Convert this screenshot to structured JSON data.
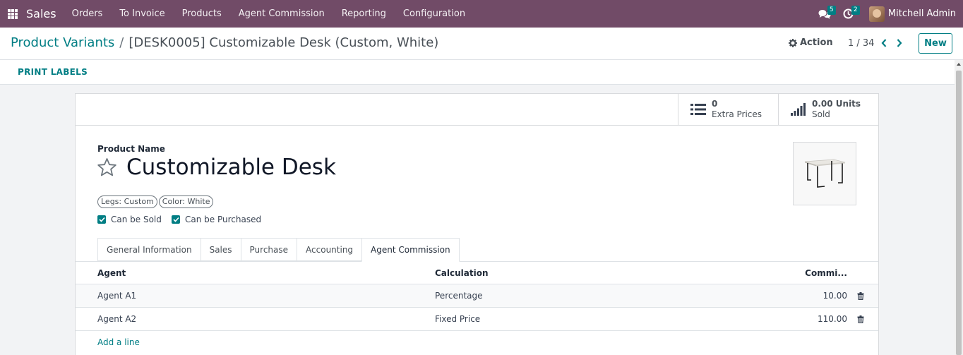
{
  "navbar": {
    "app_name": "Sales",
    "menu": [
      "Orders",
      "To Invoice",
      "Products",
      "Agent Commission",
      "Reporting",
      "Configuration"
    ],
    "messages_count": "5",
    "activities_count": "2",
    "user_name": "Mitchell Admin"
  },
  "control": {
    "breadcrumb_parent": "Product Variants",
    "breadcrumb_separator": "/",
    "breadcrumb_current": "[DESK0005] Customizable Desk (Custom, White)",
    "action_label": "Action",
    "pager_value": "1 / 34",
    "new_label": "New"
  },
  "statusbar": {
    "print_labels": "PRINT LABELS"
  },
  "smart_buttons": {
    "extra_prices": {
      "value": "0",
      "label": "Extra Prices",
      "icon": "list-icon"
    },
    "units_sold": {
      "value": "0.00 Units",
      "label": "Sold",
      "icon": "signal-icon"
    }
  },
  "form": {
    "product_name_label": "Product Name",
    "product_name": "Customizable Desk",
    "tags": [
      "Legs: Custom",
      "Color: White"
    ],
    "can_be_sold": "Can be Sold",
    "can_be_purchased": "Can be Purchased"
  },
  "tabs": [
    "General Information",
    "Sales",
    "Purchase",
    "Accounting",
    "Agent Commission"
  ],
  "commission_table": {
    "headers": {
      "agent": "Agent",
      "calculation": "Calculation",
      "commission": "Commi..."
    },
    "rows": [
      {
        "agent": "Agent A1",
        "calculation": "Percentage",
        "commission": "10.00"
      },
      {
        "agent": "Agent A2",
        "calculation": "Fixed Price",
        "commission": "110.00"
      }
    ],
    "add_line": "Add a line"
  },
  "colors": {
    "navbar": "#714b67",
    "accent": "#017e84",
    "badge": "#017e84"
  }
}
